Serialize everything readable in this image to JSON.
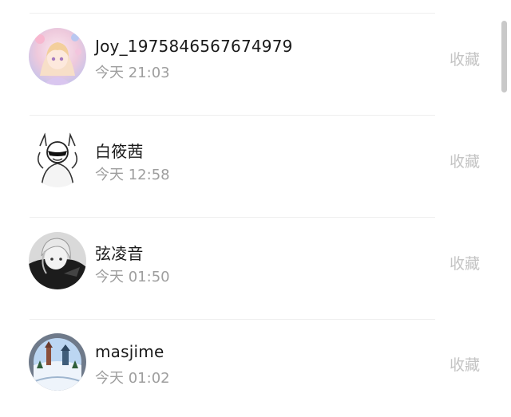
{
  "users": [
    {
      "name": "Joy_1975846567674979",
      "time": "今天 21:03",
      "action": "收藏",
      "avatar": "anime-girl-pastel-avatar"
    },
    {
      "name": "白筱茜",
      "time": "今天 12:58",
      "action": "收藏",
      "avatar": "sketch-character-avatar"
    },
    {
      "name": "弦凌音",
      "time": "今天 01:50",
      "action": "收藏",
      "avatar": "monochrome-character-avatar"
    },
    {
      "name": "masjime",
      "time": "今天 01:02",
      "action": "收藏",
      "avatar": "snow-globe-avatar"
    }
  ]
}
